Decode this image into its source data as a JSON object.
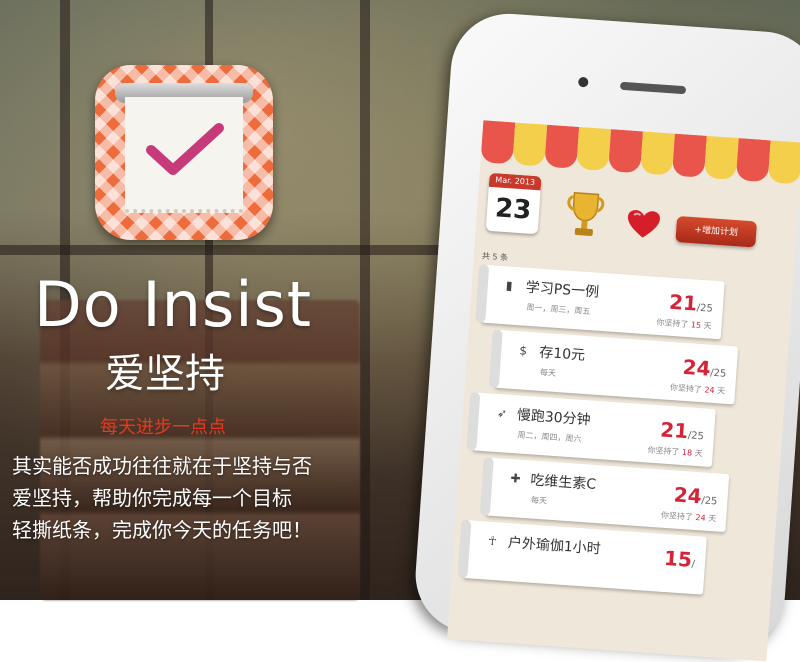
{
  "branding": {
    "title": "Do Insist",
    "subtitle": "爱坚持",
    "slogan": "每天进步一点点",
    "description_lines": [
      "其实能否成功往往就在于坚持与否",
      "爱坚持，帮助你完成每一个目标",
      "轻撕纸条，完成你今天的任务吧！"
    ]
  },
  "colors": {
    "accent": "#d4243a",
    "slogan": "#e53a1f",
    "awning_red": "#e9554a",
    "awning_yellow": "#f4cf4b"
  },
  "app": {
    "calendar": {
      "month": "Mar. 2013",
      "day": "23"
    },
    "icons": {
      "trophy": "trophy-icon",
      "heart": "heart-icon"
    },
    "add_button": "+增加计划",
    "count_label": "共 5 条",
    "items": [
      {
        "icon": "book-icon",
        "name": "学习PS一例",
        "days": "周一，周三，周五",
        "done": "21",
        "total": "/25",
        "streak_prefix": "你坚持了",
        "streak": "15",
        "streak_suffix": "天"
      },
      {
        "icon": "money-bag-icon",
        "name": "存10元",
        "days": "每天",
        "done": "24",
        "total": "/25",
        "streak_prefix": "你坚持了",
        "streak": "24",
        "streak_suffix": "天"
      },
      {
        "icon": "runner-icon",
        "name": "慢跑30分钟",
        "days": "周二，周四，周六",
        "done": "21",
        "total": "/25",
        "streak_prefix": "你坚持了",
        "streak": "18",
        "streak_suffix": "天"
      },
      {
        "icon": "medkit-icon",
        "name": "吃维生素C",
        "days": "每天",
        "done": "24",
        "total": "/25",
        "streak_prefix": "你坚持了",
        "streak": "24",
        "streak_suffix": "天"
      },
      {
        "icon": "yoga-icon",
        "name": "户外瑜伽1小时",
        "days": "",
        "done": "15",
        "total": "/",
        "streak_prefix": "",
        "streak": "",
        "streak_suffix": ""
      }
    ]
  }
}
